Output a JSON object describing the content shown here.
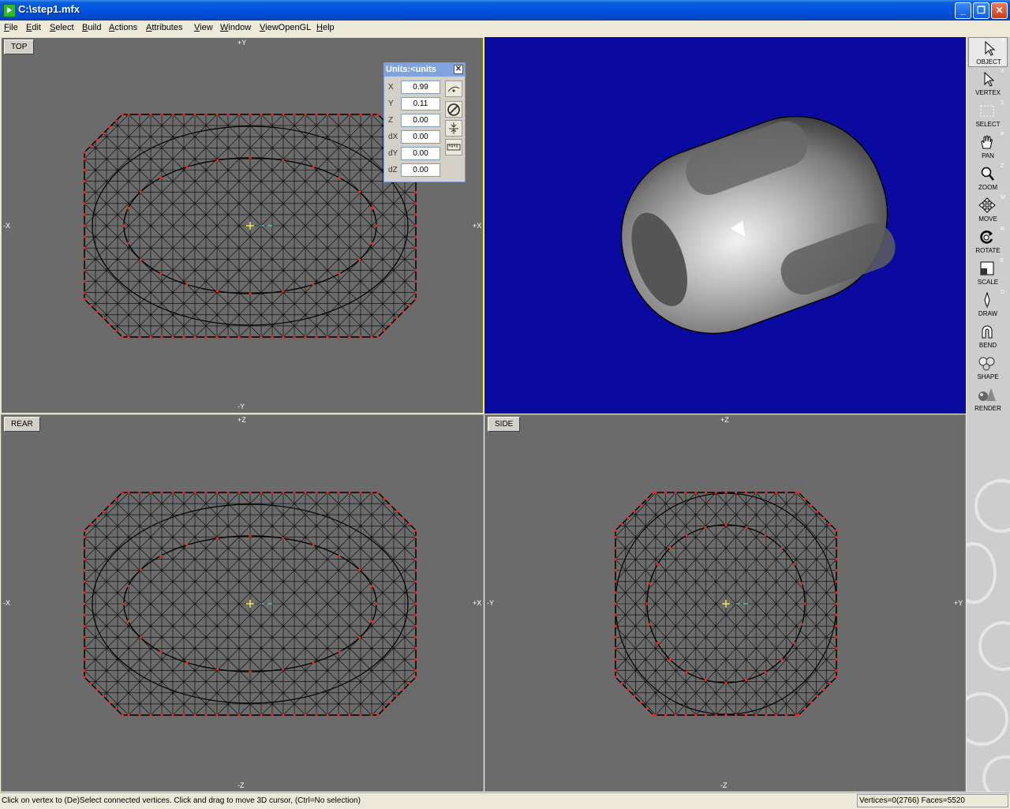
{
  "window": {
    "title": "C:\\step1.mfx",
    "minimize": "_",
    "maximize": "❐",
    "close": "✕"
  },
  "menu": [
    "File",
    "Edit",
    "Select",
    "Build",
    "Actions",
    "Attributes",
    "View",
    "Window",
    "ViewOpenGL",
    "Help"
  ],
  "viewports": {
    "top": {
      "label": "TOP",
      "axis_top": "+Y",
      "axis_bottom": "-Y",
      "axis_left": "-X",
      "axis_right": "+X"
    },
    "rear": {
      "label": "REAR",
      "axis_top": "+Z",
      "axis_bottom": "-Z",
      "axis_left": "-X",
      "axis_right": "+X"
    },
    "side": {
      "label": "SIDE",
      "axis_top": "+Z",
      "axis_bottom": "-Z",
      "axis_left": "-Y",
      "axis_right": "+Y"
    }
  },
  "units_panel": {
    "title": "Units:<units",
    "rows": [
      {
        "label": "X",
        "value": "0.99"
      },
      {
        "label": "Y",
        "value": "0.11"
      },
      {
        "label": "Z",
        "value": "0.00"
      },
      {
        "label": "dX",
        "value": "0.00"
      },
      {
        "label": "dY",
        "value": "0.00"
      },
      {
        "label": "dZ",
        "value": "0.00"
      }
    ]
  },
  "toolbar": [
    {
      "label": "OBJECT",
      "key": "O",
      "icon": "cursor-arrow-icon",
      "active": true
    },
    {
      "label": "VERTEX",
      "key": "V",
      "icon": "vertex-arrow-icon"
    },
    {
      "label": "SELECT",
      "key": "S",
      "icon": "marquee-select-icon"
    },
    {
      "label": "PAN",
      "key": "P",
      "icon": "hand-icon"
    },
    {
      "label": "ZOOM",
      "key": "Z",
      "icon": "magnifier-icon"
    },
    {
      "label": "MOVE",
      "key": "M",
      "icon": "move-arrows-icon"
    },
    {
      "label": "ROTATE",
      "key": "R",
      "icon": "rotate-icon"
    },
    {
      "label": "SCALE",
      "key": "E",
      "icon": "scale-icon"
    },
    {
      "label": "DRAW",
      "key": "D",
      "icon": "pen-icon"
    },
    {
      "label": "BEND",
      "key": "",
      "icon": "magnet-icon"
    },
    {
      "label": "SHAPE",
      "key": "",
      "icon": "spheres-icon"
    },
    {
      "label": "RENDER",
      "key": "",
      "icon": "render-cone-icon"
    }
  ],
  "status": {
    "message": "Click on vertex to (De)Select connected vertices. Click and drag to move 3D cursor, (Ctrl=No selection)",
    "stats": "Vertices=0(2766) Faces=5520"
  },
  "colors": {
    "viewport_bg": "#6b6b6b",
    "perspective_bg": "#0a0aa0",
    "vertex_red": "#ff2020",
    "edge_black": "#000000",
    "active_border": "#ffff00"
  }
}
